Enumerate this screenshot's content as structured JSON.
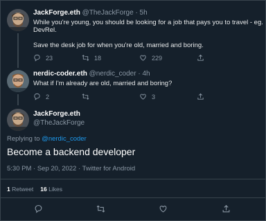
{
  "tweet1": {
    "name": "JackForge.eth",
    "meta": "@TheJackForge · 5h",
    "text_line1": "While you're young, you should be looking for a job that pays you to travel - eg.",
    "text_line2": "DevRel.",
    "text_line3": "Save the desk job for when you're old, married and boring.",
    "replies": "23",
    "retweets": "18",
    "likes": "229"
  },
  "tweet2": {
    "name": "nerdic-coder.eth",
    "meta": "@nerdic_coder · 4h",
    "text": "What if I'm already are old, married and boring?",
    "replies": "2",
    "retweets": "",
    "likes": "3"
  },
  "main_tweet": {
    "name": "JackForge.eth",
    "handle": "@TheJackForge",
    "replying_prefix": "Replying to ",
    "replying_handle": "@nerdic_coder",
    "text": "Become a backend developer",
    "timestamp": "5:30 PM · Sep 20, 2022 · Twitter for Android",
    "retweet_count": "1",
    "retweet_label": "Retweet",
    "like_count": "16",
    "like_label": "Likes"
  },
  "colors": {
    "background": "#15202b",
    "muted": "#8b98a5",
    "accent": "#1d9bf0",
    "border": "#38444d"
  },
  "icons": [
    "reply-icon",
    "retweet-icon",
    "like-icon",
    "share-icon"
  ]
}
